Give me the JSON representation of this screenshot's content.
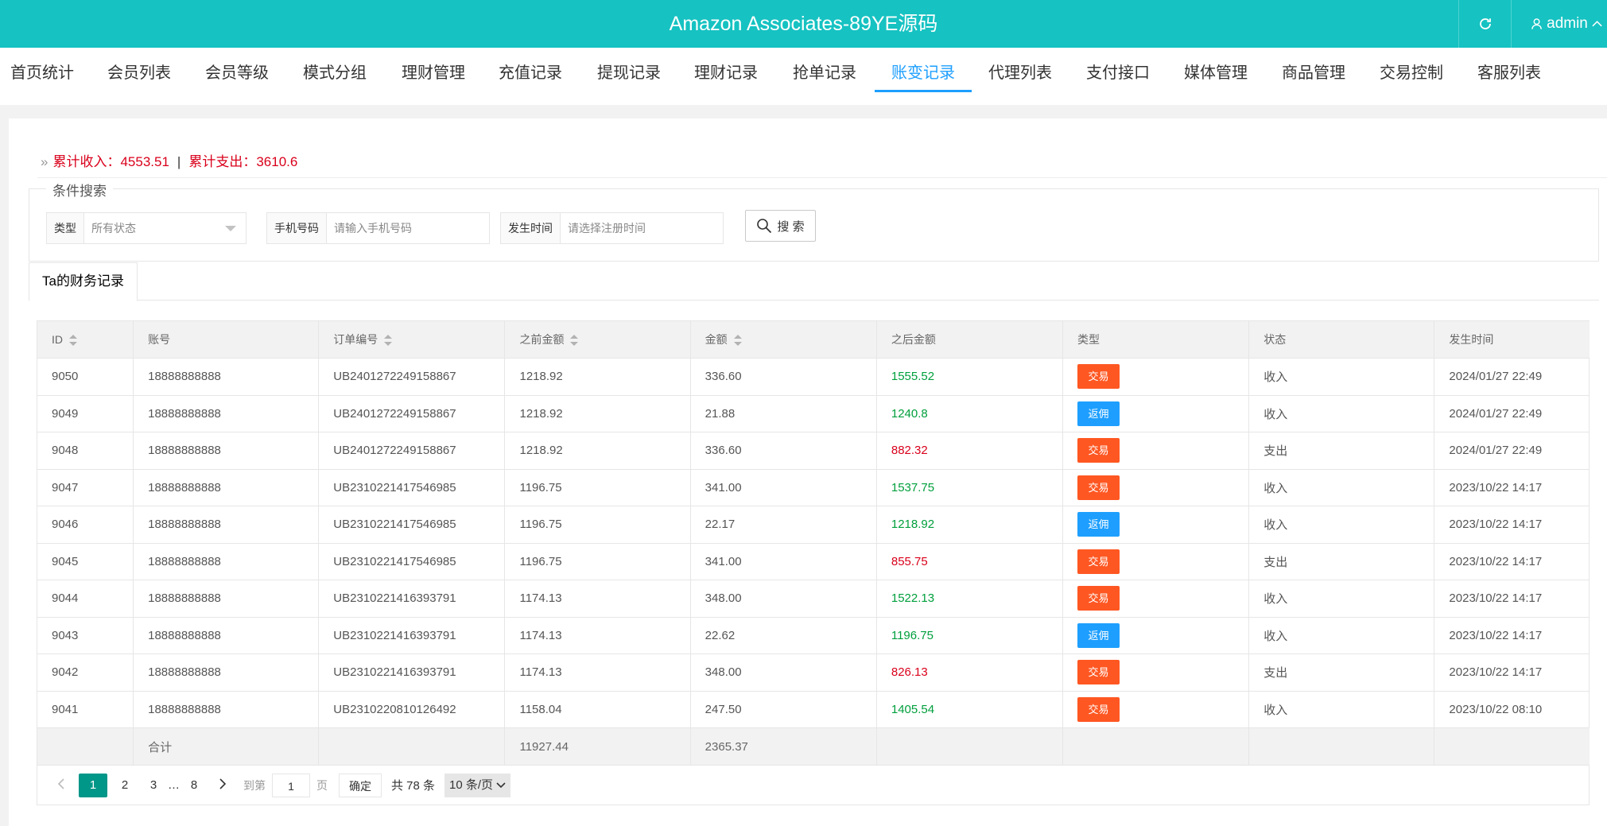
{
  "header": {
    "title": "Amazon Associates-89YE源码",
    "user": "admin"
  },
  "nav": {
    "items": [
      "首页统计",
      "会员列表",
      "会员等级",
      "模式分组",
      "理财管理",
      "充值记录",
      "提现记录",
      "理财记录",
      "抢单记录",
      "账变记录",
      "代理列表",
      "支付接口",
      "媒体管理",
      "商品管理",
      "交易控制",
      "客服列表"
    ],
    "active": "账变记录"
  },
  "summary": {
    "income_label": "累计收入：",
    "income_value": "4553.51",
    "separator": "|",
    "expense_label": "累计支出：",
    "expense_value": "3610.6"
  },
  "filters": {
    "legend": "条件搜索",
    "type_label": "类型",
    "type_value": "所有状态",
    "phone_label": "手机号码",
    "phone_placeholder": "请输入手机号码",
    "time_label": "发生时间",
    "time_placeholder": "请选择注册时间",
    "search_label": "搜 索"
  },
  "tab": {
    "label": "Ta的财务记录"
  },
  "table": {
    "columns": [
      "ID",
      "账号",
      "订单编号",
      "之前金额",
      "金额",
      "之后金额",
      "类型",
      "状态",
      "发生时间"
    ],
    "rows": [
      {
        "id": "9050",
        "account": "18888888888",
        "order": "UB2401272249158867",
        "before": "1218.92",
        "amount": "336.60",
        "after": "1555.52",
        "after_color": "green",
        "type": "交易",
        "type_kind": "trade",
        "status": "收入",
        "time": "2024/01/27 22:49"
      },
      {
        "id": "9049",
        "account": "18888888888",
        "order": "UB2401272249158867",
        "before": "1218.92",
        "amount": "21.88",
        "after": "1240.8",
        "after_color": "green",
        "type": "返佣",
        "type_kind": "rebate",
        "status": "收入",
        "time": "2024/01/27 22:49"
      },
      {
        "id": "9048",
        "account": "18888888888",
        "order": "UB2401272249158867",
        "before": "1218.92",
        "amount": "336.60",
        "after": "882.32",
        "after_color": "red",
        "type": "交易",
        "type_kind": "trade",
        "status": "支出",
        "time": "2024/01/27 22:49"
      },
      {
        "id": "9047",
        "account": "18888888888",
        "order": "UB2310221417546985",
        "before": "1196.75",
        "amount": "341.00",
        "after": "1537.75",
        "after_color": "green",
        "type": "交易",
        "type_kind": "trade",
        "status": "收入",
        "time": "2023/10/22 14:17"
      },
      {
        "id": "9046",
        "account": "18888888888",
        "order": "UB2310221417546985",
        "before": "1196.75",
        "amount": "22.17",
        "after": "1218.92",
        "after_color": "green",
        "type": "返佣",
        "type_kind": "rebate",
        "status": "收入",
        "time": "2023/10/22 14:17"
      },
      {
        "id": "9045",
        "account": "18888888888",
        "order": "UB2310221417546985",
        "before": "1196.75",
        "amount": "341.00",
        "after": "855.75",
        "after_color": "red",
        "type": "交易",
        "type_kind": "trade",
        "status": "支出",
        "time": "2023/10/22 14:17"
      },
      {
        "id": "9044",
        "account": "18888888888",
        "order": "UB2310221416393791",
        "before": "1174.13",
        "amount": "348.00",
        "after": "1522.13",
        "after_color": "green",
        "type": "交易",
        "type_kind": "trade",
        "status": "收入",
        "time": "2023/10/22 14:17"
      },
      {
        "id": "9043",
        "account": "18888888888",
        "order": "UB2310221416393791",
        "before": "1174.13",
        "amount": "22.62",
        "after": "1196.75",
        "after_color": "green",
        "type": "返佣",
        "type_kind": "rebate",
        "status": "收入",
        "time": "2023/10/22 14:17"
      },
      {
        "id": "9042",
        "account": "18888888888",
        "order": "UB2310221416393791",
        "before": "1174.13",
        "amount": "348.00",
        "after": "826.13",
        "after_color": "red",
        "type": "交易",
        "type_kind": "trade",
        "status": "支出",
        "time": "2023/10/22 14:17"
      },
      {
        "id": "9041",
        "account": "18888888888",
        "order": "UB2310220810126492",
        "before": "1158.04",
        "amount": "247.50",
        "after": "1405.54",
        "after_color": "green",
        "type": "交易",
        "type_kind": "trade",
        "status": "收入",
        "time": "2023/10/22 08:10"
      }
    ],
    "footer": {
      "label": "合计",
      "before_total": "11927.44",
      "amount_total": "2365.37"
    }
  },
  "pager": {
    "pages": [
      "1",
      "2",
      "3"
    ],
    "ellipsis": "…",
    "last_page": "8",
    "goto_label": "到第",
    "goto_value": "1",
    "page_unit": "页",
    "confirm_label": "确定",
    "total_text": "共 78 条",
    "per_page": "10 条/页"
  }
}
